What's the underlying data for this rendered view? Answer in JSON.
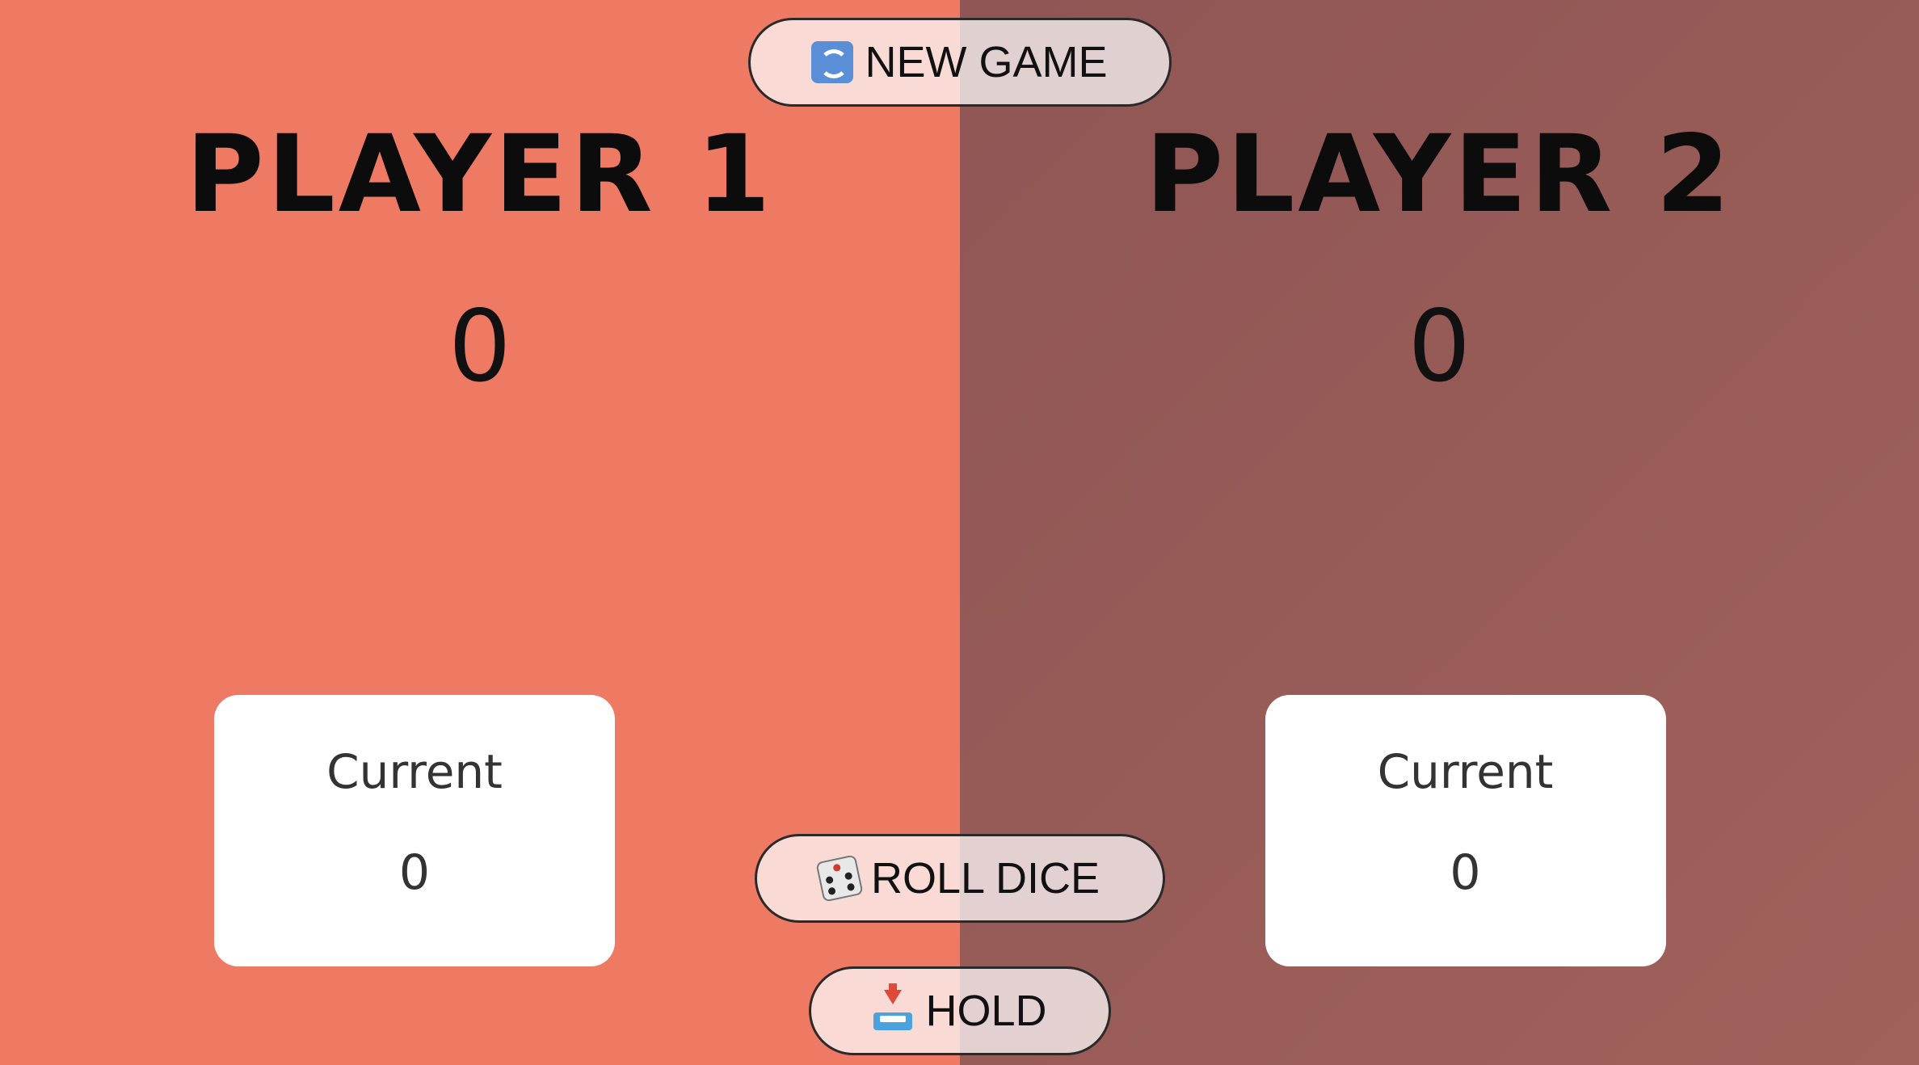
{
  "players": [
    {
      "name": "PLAYER 1",
      "score": "0",
      "current_label": "Current",
      "current_score": "0",
      "active": true
    },
    {
      "name": "PLAYER 2",
      "score": "0",
      "current_label": "Current",
      "current_score": "0",
      "active": false
    }
  ],
  "buttons": {
    "new_game": {
      "label": "NEW GAME",
      "icon": "refresh-icon"
    },
    "roll_dice": {
      "label": "ROLL DICE",
      "icon": "dice-icon"
    },
    "hold": {
      "label": "HOLD",
      "icon": "inbox-tray-icon"
    }
  },
  "colors": {
    "player1_bg": "#ee7a64",
    "player2_bg": "#965b57",
    "button_bg": "rgba(255,255,255,0.72)",
    "text": "#0c0c0c"
  }
}
